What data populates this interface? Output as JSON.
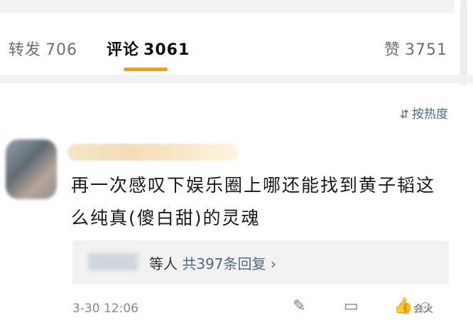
{
  "tabs": {
    "repost": {
      "label": "转发",
      "count": "706"
    },
    "comment": {
      "label": "评论",
      "count": "3061"
    },
    "like": {
      "label": "赞",
      "count": "3751"
    }
  },
  "sort": {
    "label": "按热度"
  },
  "comment": {
    "text": "再一次感叹下娱乐圈上哪还能找到黄子韬这么纯真(傻白甜)的灵魂",
    "replies": {
      "text": "等人",
      "link": "共397条回复",
      "chevron": "›"
    },
    "timestamp": "3-30 12:06"
  },
  "watermark": "会火"
}
